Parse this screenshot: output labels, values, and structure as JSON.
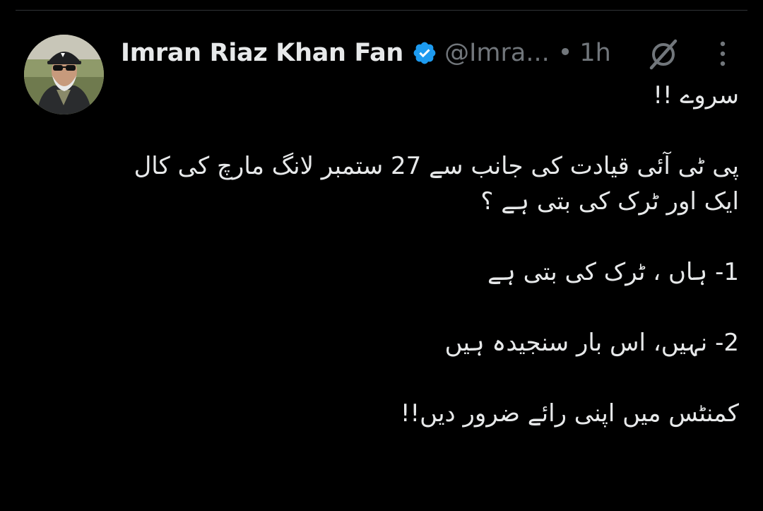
{
  "tweet": {
    "author": {
      "display_name": "Imran Riaz Khan Fan",
      "handle": "@Imra...",
      "verified": true,
      "avatar_icon": "avatar-photo"
    },
    "separator": "•",
    "timestamp": "1h",
    "icons": {
      "grok": "grok-slash-icon",
      "more": "more-vertical-icon"
    },
    "body": {
      "line1": "سروے !!",
      "paragraph2": "پی ٹی آئی قیادت کی جانب سے 27 ستمبر لانگ مارچ کی کال ایک اور ٹرک کی بتی ہے ؟",
      "option1": "1- ہاں ، ٹرک کی بتی ہے",
      "option2": "2- نہیں، اس بار سنجیدہ ہیں",
      "closing": "کمنٹس میں اپنی رائے ضرور دیں!!"
    }
  },
  "colors": {
    "background": "#000000",
    "text": "#e7e9ea",
    "secondary": "#71767b",
    "verified_blue": "#1d9bf0",
    "divider": "#2f3336"
  }
}
